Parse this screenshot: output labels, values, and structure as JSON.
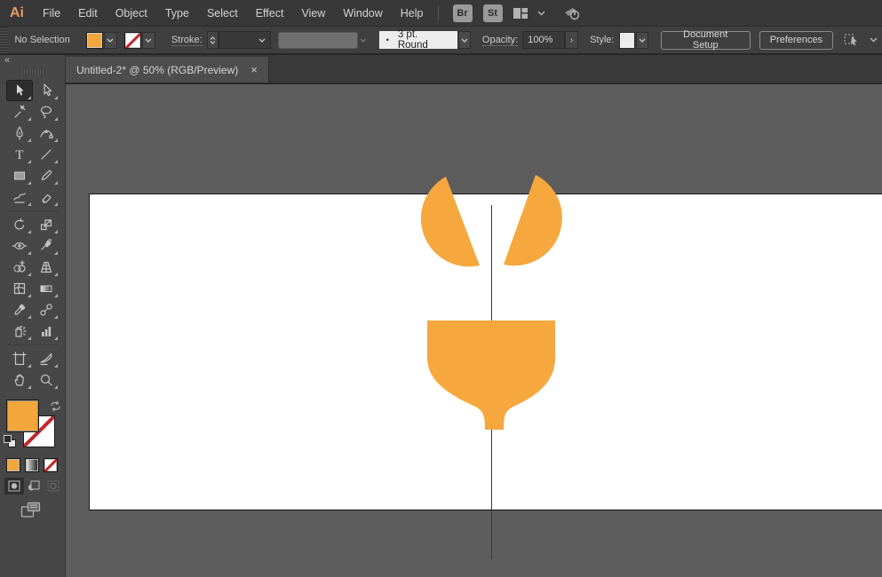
{
  "app": {
    "logo_text": "Ai"
  },
  "menubar": {
    "items": [
      "File",
      "Edit",
      "Object",
      "Type",
      "Select",
      "Effect",
      "View",
      "Window",
      "Help"
    ],
    "bridge_button": "Br",
    "stock_button": "St"
  },
  "control_bar": {
    "selection_status": "No Selection",
    "fill_color": "#f3a63c",
    "stroke_setting": "none",
    "stroke_label": "Stroke:",
    "stroke_width_value": "",
    "brush_bullet": "•",
    "brush_definition": "3 pt. Round",
    "opacity_label": "Opacity:",
    "opacity_value": "100%",
    "style_label": "Style:",
    "document_setup_button": "Document Setup",
    "preferences_button": "Preferences"
  },
  "document_tab": {
    "title": "Untitled-2* @ 50% (RGB/Preview)",
    "close_glyph": "×"
  },
  "toolbar": {
    "collapse_glyph": "«",
    "active_tool": "selection",
    "tools": [
      "selection",
      "direct-selection",
      "magic-wand",
      "lasso",
      "pen",
      "curvature",
      "type",
      "line-segment",
      "rectangle",
      "paintbrush",
      "shaper",
      "eraser",
      "rotate",
      "scale",
      "width",
      "puppet-warp",
      "shape-builder",
      "perspective-grid",
      "mesh",
      "gradient",
      "eyedropper",
      "blend",
      "symbol-sprayer",
      "column-graph",
      "artboard",
      "slice",
      "hand",
      "zoom"
    ],
    "fill_color": "#f3a63c",
    "stroke_color": "none",
    "swatch_buttons": [
      "color",
      "gradient",
      "none"
    ],
    "drawing_modes": [
      "draw-normal",
      "draw-behind",
      "draw-inside"
    ],
    "active_drawing_mode": "draw-normal"
  },
  "canvas": {
    "pasteboard_color": "#5d5d5d",
    "artboard_color": "#ffffff",
    "shape_color": "#f6a83f",
    "shapes": [
      "left-petal",
      "right-petal",
      "bikini-bottom"
    ],
    "guide": "vertical-center-line",
    "zoom_level": "50%"
  }
}
